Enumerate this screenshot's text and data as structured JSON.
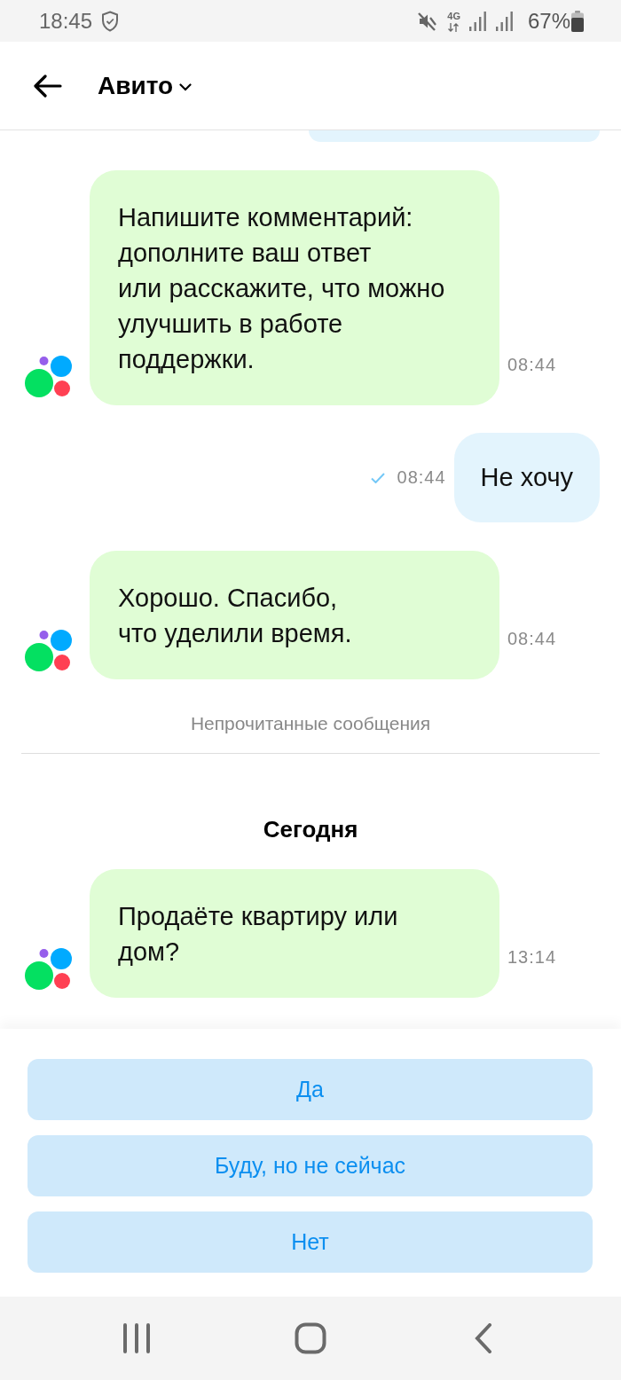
{
  "status_bar": {
    "time": "18:45",
    "network": "4G",
    "battery": "67%"
  },
  "header": {
    "title": "Авито"
  },
  "chat": {
    "clipped_bubble_above": true,
    "items": [
      {
        "kind": "incoming_message",
        "text": "Напишите комментарий:\nдополните ваш ответ\nили расскажите, что можно\nулучшить в работе\nподдержки.",
        "time": "08:44"
      },
      {
        "kind": "outgoing_message",
        "text": "Не хочу",
        "time": "08:44",
        "delivered": true
      },
      {
        "kind": "incoming_message",
        "text": "Хорошо. Спасибо,\nчто уделили время.",
        "time": "08:44"
      },
      {
        "kind": "unread_divider",
        "text": "Непрочитанные сообщения"
      },
      {
        "kind": "date_header",
        "text": "Сегодня"
      },
      {
        "kind": "incoming_message",
        "text": "Продаёте квартиру или\nдом?",
        "time": "13:14"
      }
    ]
  },
  "quick_replies": [
    "Да",
    "Буду, но не сейчас",
    "Нет"
  ]
}
